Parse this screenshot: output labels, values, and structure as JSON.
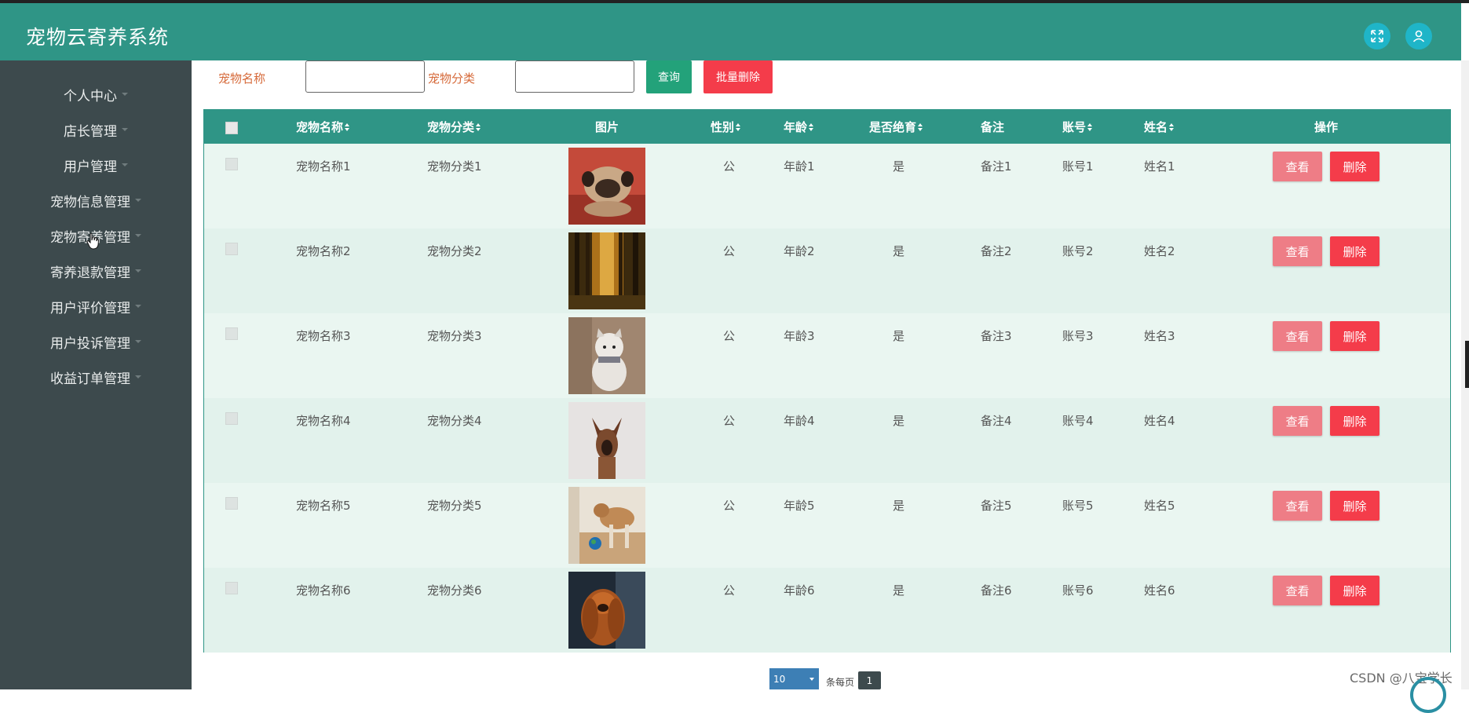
{
  "app": {
    "title": "宠物云寄养系统"
  },
  "header": {
    "fullscreen_icon": "expand-icon",
    "user_icon": "user-icon"
  },
  "sidebar": {
    "items": [
      {
        "label": "个人中心"
      },
      {
        "label": "店长管理"
      },
      {
        "label": "用户管理"
      },
      {
        "label": "宠物信息管理"
      },
      {
        "label": "宠物寄养管理"
      },
      {
        "label": "寄养退款管理"
      },
      {
        "label": "用户评价管理"
      },
      {
        "label": "用户投诉管理"
      },
      {
        "label": "收益订单管理"
      }
    ]
  },
  "search": {
    "name_label": "宠物名称",
    "name_value": "",
    "category_label": "宠物分类",
    "category_value": "",
    "query_button": "查询",
    "batch_delete_button": "批量删除",
    "colors": {
      "query": "#23a27a",
      "batch_delete": "#f43c4a"
    }
  },
  "table": {
    "columns": [
      "宠物名称",
      "宠物分类",
      "图片",
      "性别",
      "年龄",
      "是否绝育",
      "备注",
      "账号",
      "姓名",
      "操作"
    ],
    "rows": [
      {
        "name": "宠物名称1",
        "category": "宠物分类1",
        "image": "pug-photo",
        "gender": "公",
        "age": "年龄1",
        "neutered": "是",
        "note": "备注1",
        "account": "账号1",
        "real_name": "姓名1"
      },
      {
        "name": "宠物名称2",
        "category": "宠物分类2",
        "image": "forest-photo",
        "gender": "公",
        "age": "年龄2",
        "neutered": "是",
        "note": "备注2",
        "account": "账号2",
        "real_name": "姓名2"
      },
      {
        "name": "宠物名称3",
        "category": "宠物分类3",
        "image": "cat-photo",
        "gender": "公",
        "age": "年龄3",
        "neutered": "是",
        "note": "备注3",
        "account": "账号3",
        "real_name": "姓名3"
      },
      {
        "name": "宠物名称4",
        "category": "宠物分类4",
        "image": "shepherd-photo",
        "gender": "公",
        "age": "年龄4",
        "neutered": "是",
        "note": "备注4",
        "account": "账号4",
        "real_name": "姓名4"
      },
      {
        "name": "宠物名称5",
        "category": "宠物分类5",
        "image": "dog-ball-photo",
        "gender": "公",
        "age": "年龄5",
        "neutered": "是",
        "note": "备注5",
        "account": "账号5",
        "real_name": "姓名5"
      },
      {
        "name": "宠物名称6",
        "category": "宠物分类6",
        "image": "longhair-dog-photo",
        "gender": "公",
        "age": "年龄6",
        "neutered": "是",
        "note": "备注6",
        "account": "账号6",
        "real_name": "姓名6"
      }
    ],
    "view_button": "查看",
    "delete_button": "删除"
  },
  "pagination": {
    "page_size": "10",
    "per_page_label": "条每页",
    "current_page": "1"
  },
  "watermark": "CSDN @八宝学长",
  "colors": {
    "header": "#2f9586",
    "sidebar": "#3d4a4d",
    "table_header": "#2f9586"
  }
}
